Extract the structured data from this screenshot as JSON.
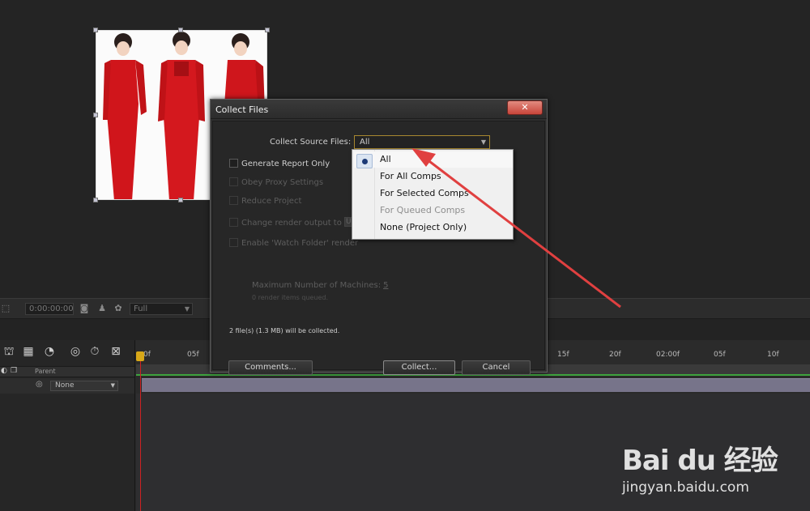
{
  "dialog": {
    "title": "Collect Files",
    "close_glyph": "✕",
    "source_label": "Collect Source Files:",
    "source_value": "All",
    "dropdown_arrow": "▼",
    "options": {
      "generate_report": "Generate Report Only",
      "obey_proxy": "Obey Proxy Settings",
      "reduce_project": "Reduce Project",
      "change_render": "Change render output to",
      "render_folder_value": "Un",
      "watch_folder": "Enable 'Watch Folder' render"
    },
    "machines_label": "Maximum Number of Machines:",
    "machines_value": "5",
    "queued_text": "0 render items queued.",
    "collected_text": "2 file(s) (1.3 MB) will be collected.",
    "buttons": {
      "comments": "Comments...",
      "collect": "Collect...",
      "cancel": "Cancel"
    }
  },
  "dropdown": {
    "items": [
      "All",
      "For All Comps",
      "For Selected Comps",
      "For Queued Comps",
      "None (Project Only)"
    ],
    "selected_index": 0,
    "disabled_index": 3
  },
  "viewer_toolbar": {
    "timecode": "0:00:00:00",
    "resolution": "Full"
  },
  "timeline": {
    "parent_header": "Parent",
    "parent_value": "None",
    "ticks": [
      "0f",
      "05f",
      "15f",
      "20f",
      "02:00f",
      "05f",
      "10f"
    ]
  },
  "watermark": {
    "logo": "Bai du 经验",
    "url": "jingyan.baidu.com"
  },
  "colors": {
    "accent_orange": "#a88830",
    "playhead_red": "#cc2222",
    "annotation_arrow": "#e04040",
    "selection_blue": "#1c3a76"
  }
}
